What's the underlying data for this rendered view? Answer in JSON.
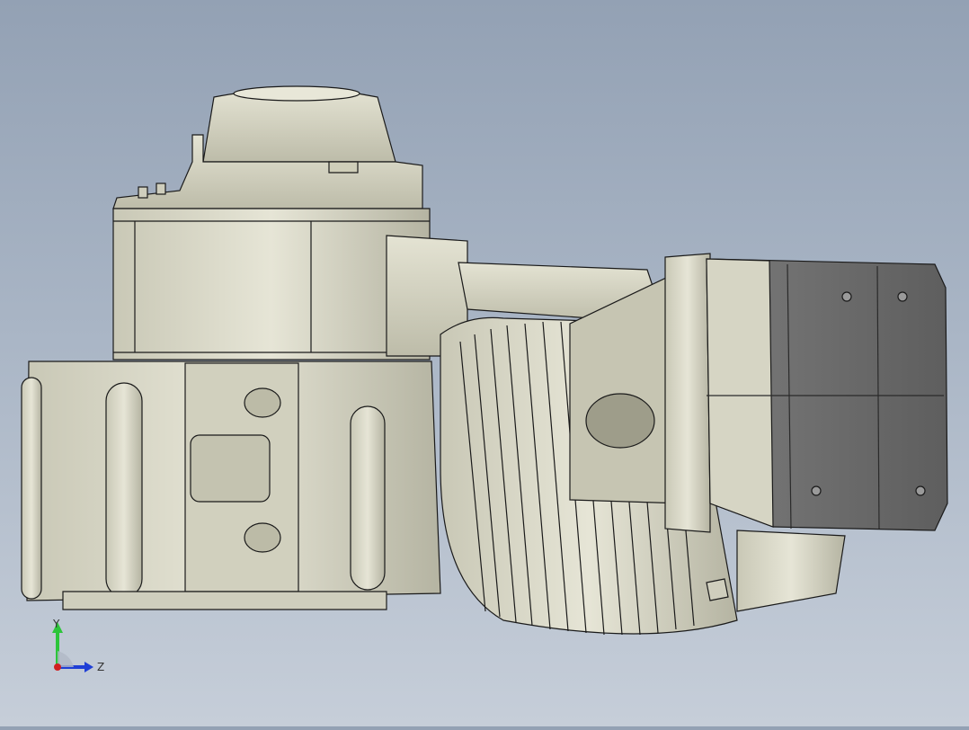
{
  "viewport": {
    "background_top": "#93a1b4",
    "background_bottom": "#c6ced9",
    "model_fill": "#d9d8c8",
    "model_shade": "#b9b8a6",
    "cover_fill": "#6a6a6a",
    "edge_color": "#1a1a1a"
  },
  "triad": {
    "y_label": "Y",
    "z_label": "Z",
    "y_color": "#2cc53a",
    "z_color": "#1f3fd6",
    "x_color": "#d02020"
  }
}
